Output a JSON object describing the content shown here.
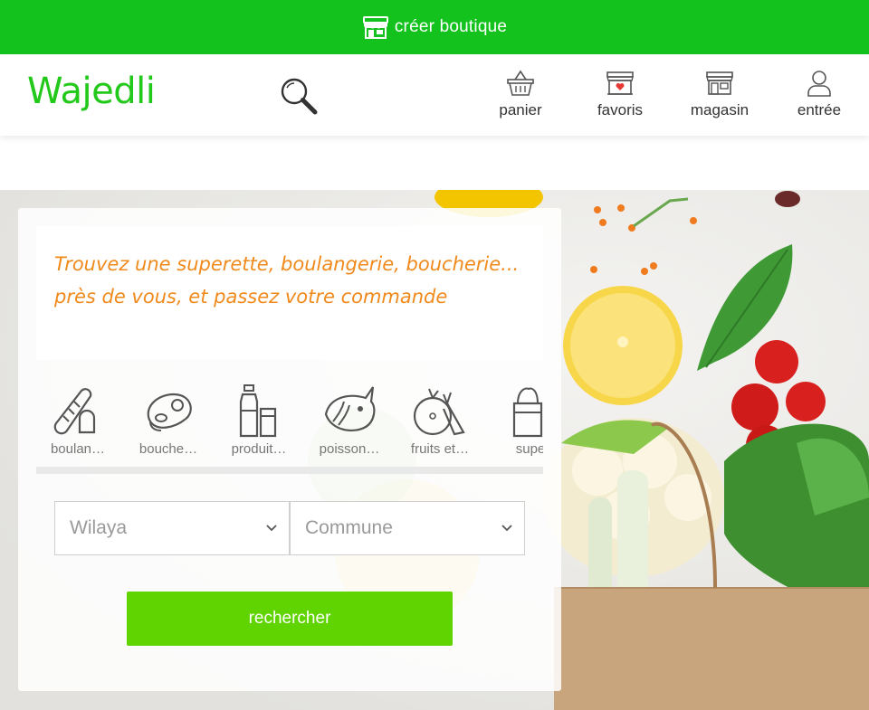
{
  "topbar": {
    "label": "créer boutique",
    "icon": "shop-icon",
    "bg_color": "#13c21d"
  },
  "header": {
    "logo": "Wajedli",
    "logo_color": "#22c91a",
    "search_icon": "magnifier-icon",
    "nav": [
      {
        "label": "panier",
        "icon": "basket-icon"
      },
      {
        "label": "favoris",
        "icon": "favorite-shop-icon"
      },
      {
        "label": "magasin",
        "icon": "store-icon"
      },
      {
        "label": "entrée",
        "icon": "user-icon"
      }
    ]
  },
  "hero": {
    "tagline": "Trouvez une superette, boulangerie, boucherie... près de vous, et passez votre commande",
    "tagline_color": "#f08a1c",
    "categories": [
      {
        "label": "boulan…",
        "icon": "bread-icon"
      },
      {
        "label": "bouche…",
        "icon": "meat-icon"
      },
      {
        "label": "produit…",
        "icon": "milk-icon"
      },
      {
        "label": "poisson…",
        "icon": "fish-icon"
      },
      {
        "label": "fruits et…",
        "icon": "fruits-vegetables-icon"
      },
      {
        "label": "supe",
        "icon": "grocery-bag-icon"
      }
    ],
    "wilaya_placeholder": "Wilaya",
    "commune_placeholder": "Commune",
    "search_button": "rechercher",
    "button_color": "#5fd401"
  }
}
